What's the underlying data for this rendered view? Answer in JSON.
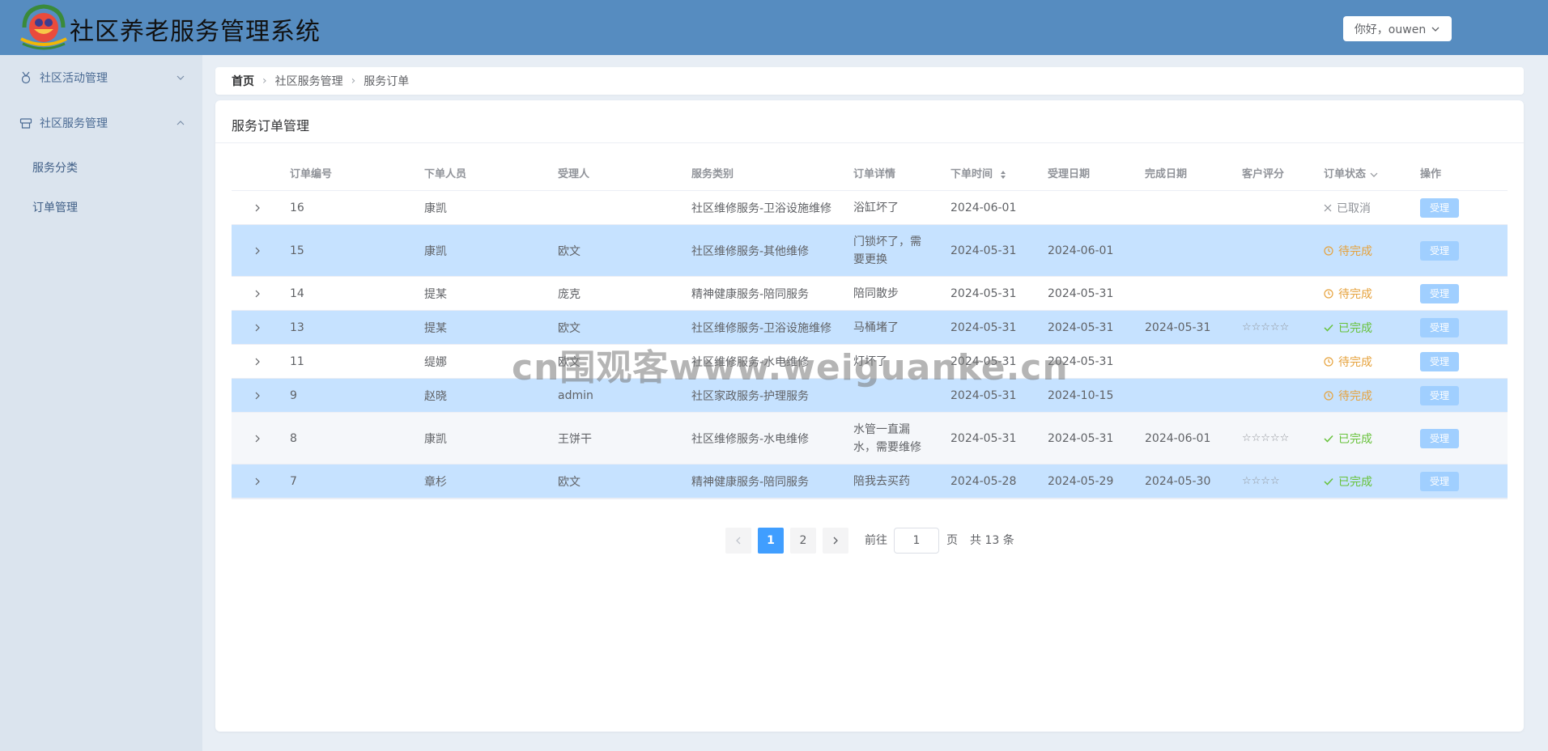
{
  "app": {
    "title": "社区养老服务管理系统",
    "user_greeting": "你好，ouwen"
  },
  "sidebar": {
    "groups": [
      {
        "label": "社区活动管理",
        "icon": "medal-icon",
        "expanded": false
      },
      {
        "label": "社区服务管理",
        "icon": "service-icon",
        "expanded": true
      }
    ],
    "sub_items": [
      {
        "label": "服务分类"
      },
      {
        "label": "订单管理"
      }
    ]
  },
  "breadcrumb": {
    "items": [
      "首页",
      "社区服务管理",
      "服务订单"
    ]
  },
  "card": {
    "title": "服务订单管理"
  },
  "table": {
    "columns": [
      "订单编号",
      "下单人员",
      "受理人",
      "服务类别",
      "订单详情",
      "下单时间",
      "受理日期",
      "完成日期",
      "客户评分",
      "订单状态",
      "操作"
    ],
    "rows": [
      {
        "id": "16",
        "orderer": "康凯",
        "handler": "",
        "category": "社区维修服务-卫浴设施维修",
        "detail": "浴缸坏了",
        "order_date": "2024-06-01",
        "accept_date": "",
        "finish_date": "",
        "rating": "",
        "status": "已取消",
        "status_type": "cancel",
        "action": "受理"
      },
      {
        "id": "15",
        "orderer": "康凯",
        "handler": "欧文",
        "category": "社区维修服务-其他维修",
        "detail": "门锁坏了，需要更换",
        "order_date": "2024-05-31",
        "accept_date": "2024-06-01",
        "finish_date": "",
        "rating": "",
        "status": "待完成",
        "status_type": "wait",
        "action": "受理"
      },
      {
        "id": "14",
        "orderer": "提某",
        "handler": "庞克",
        "category": "精神健康服务-陪同服务",
        "detail": "陪同散步",
        "order_date": "2024-05-31",
        "accept_date": "2024-05-31",
        "finish_date": "",
        "rating": "",
        "status": "待完成",
        "status_type": "wait",
        "action": "受理"
      },
      {
        "id": "13",
        "orderer": "提某",
        "handler": "欧文",
        "category": "社区维修服务-卫浴设施维修",
        "detail": "马桶堵了",
        "order_date": "2024-05-31",
        "accept_date": "2024-05-31",
        "finish_date": "2024-05-31",
        "rating": "☆☆☆☆☆",
        "status": "已完成",
        "status_type": "done",
        "action": "受理"
      },
      {
        "id": "11",
        "orderer": "缇娜",
        "handler": "欧文",
        "category": "社区维修服务-水电维修",
        "detail": "灯坏了",
        "order_date": "2024-05-31",
        "accept_date": "2024-05-31",
        "finish_date": "",
        "rating": "",
        "status": "待完成",
        "status_type": "wait",
        "action": "受理"
      },
      {
        "id": "9",
        "orderer": "赵晓",
        "handler": "admin",
        "category": "社区家政服务-护理服务",
        "detail": "",
        "order_date": "2024-05-31",
        "accept_date": "2024-10-15",
        "finish_date": "",
        "rating": "",
        "status": "待完成",
        "status_type": "wait",
        "action": "受理"
      },
      {
        "id": "8",
        "orderer": "康凯",
        "handler": "王饼干",
        "category": "社区维修服务-水电维修",
        "detail": "水管一直漏水，需要维修",
        "order_date": "2024-05-31",
        "accept_date": "2024-05-31",
        "finish_date": "2024-06-01",
        "rating": "☆☆☆☆☆",
        "status": "已完成",
        "status_type": "done",
        "action": "受理"
      },
      {
        "id": "7",
        "orderer": "章杉",
        "handler": "欧文",
        "category": "精神健康服务-陪同服务",
        "detail": "陪我去买药",
        "order_date": "2024-05-28",
        "accept_date": "2024-05-29",
        "finish_date": "2024-05-30",
        "rating": "☆☆☆☆",
        "status": "已完成",
        "status_type": "done",
        "action": "受理"
      }
    ]
  },
  "pagination": {
    "pages": [
      "1",
      "2"
    ],
    "current": "1",
    "goto_label": "前往",
    "goto_value": "1",
    "page_suffix": "页",
    "total_text": "共 13 条"
  },
  "watermark": "cn围观客www.weiguanke.cn",
  "colors": {
    "header": "#568cc0",
    "sidebar": "#dbe4ee",
    "row_highlight": "#c6e2ff",
    "primary": "#409eff",
    "wait": "#e6a23c",
    "done": "#67c23a"
  }
}
